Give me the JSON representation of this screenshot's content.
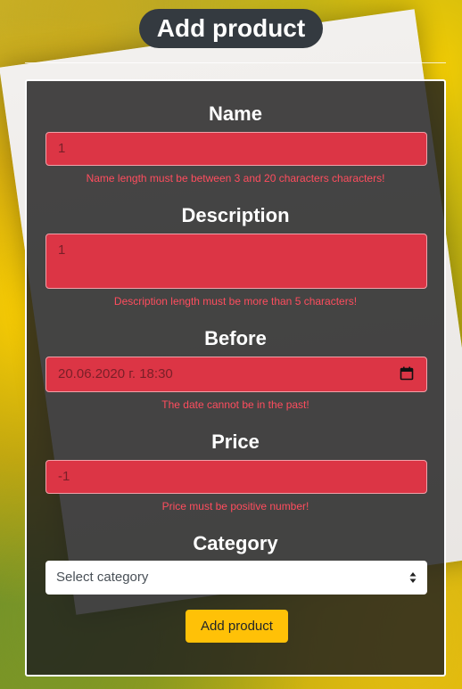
{
  "page": {
    "title": "Add product"
  },
  "form": {
    "name": {
      "label": "Name",
      "value": "1",
      "error": "Name length must be between 3 and 20 characters characters!"
    },
    "description": {
      "label": "Description",
      "value": "1",
      "error": "Description length must be more than 5 characters!"
    },
    "before": {
      "label": "Before",
      "value": "20.06.2020 г. 18:30",
      "error": "The date cannot be in the past!",
      "icon": "calendar-icon"
    },
    "price": {
      "label": "Price",
      "value": "-1",
      "error": "Price must be positive number!"
    },
    "category": {
      "label": "Category",
      "selected": "Select category",
      "icon": "select-caret-icon"
    },
    "submit_label": "Add product"
  },
  "colors": {
    "error_field": "#dc3545",
    "error_text": "#ff4d5e",
    "button": "#ffc107",
    "panel": "#1e1e1e"
  }
}
